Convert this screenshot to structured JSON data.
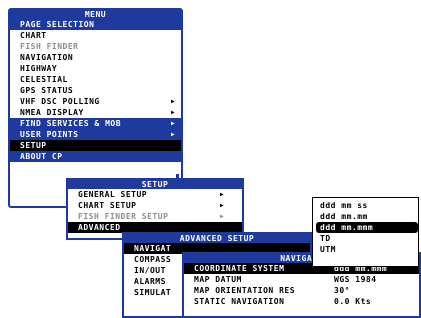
{
  "main_menu": {
    "title": "MENU",
    "section_header": "PAGE SELECTION",
    "pages": [
      "CHART",
      "FISH FINDER",
      "NAVIGATION",
      "HIGHWAY",
      "CELESTIAL",
      "GPS STATUS",
      "VHF DSC POLLING",
      "NMEA DISPLAY"
    ],
    "find_services": "FIND SERVICES & MOB",
    "user_points": "USER POINTS",
    "setup": "SETUP",
    "about": "ABOUT CP"
  },
  "setup_menu": {
    "title": "SETUP",
    "items": [
      "GENERAL SETUP",
      "CHART SETUP",
      "FISH FINDER SETUP",
      "ADVANCED"
    ]
  },
  "advanced_menu": {
    "title": "ADVANCED SETUP",
    "items": [
      "NAVIGAT",
      "COMPASS",
      "IN/OUT",
      "ALARMS",
      "SIMULAT"
    ]
  },
  "navigation_menu": {
    "title": "NAVIGATI",
    "rows": [
      {
        "label": "COORDINATE SYSTEM",
        "value": "ddd mm.mmm"
      },
      {
        "label": "MAP DATUM",
        "value": "WGS 1984"
      },
      {
        "label": "MAP ORIENTATION RES",
        "value": "30°"
      },
      {
        "label": "STATIC NAVIGATION",
        "value": "0.0 Kts"
      }
    ]
  },
  "coordinate_options": [
    "ddd mm ss",
    "ddd mm.mm",
    "ddd mm.mmm",
    "TD",
    "UTM"
  ],
  "colors": {
    "title_bar": "#1e3a9c",
    "highlight": "#000000",
    "disabled_text": "#8d8d8d"
  }
}
